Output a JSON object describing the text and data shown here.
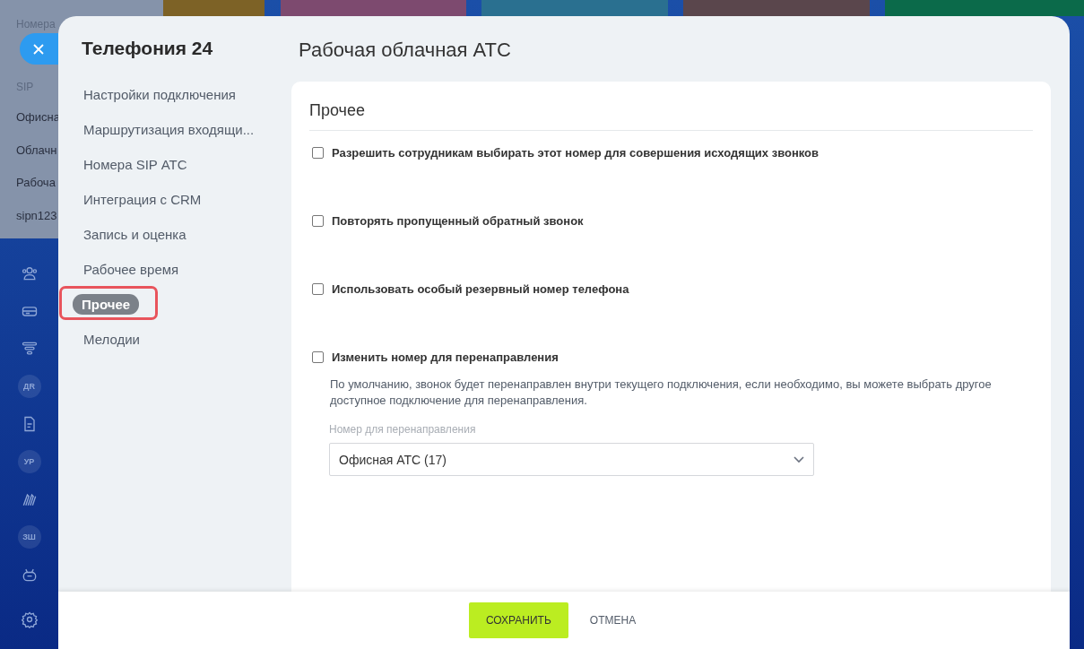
{
  "background_popup": {
    "heading": "Номера",
    "section": "SIP",
    "items": [
      "Офисна",
      "Облачн",
      "Рабоча",
      "sipn123"
    ]
  },
  "rail": [
    {
      "kind": "icon"
    },
    {
      "kind": "icon"
    },
    {
      "kind": "icon"
    },
    {
      "kind": "badge",
      "text": "ДR"
    },
    {
      "kind": "icon"
    },
    {
      "kind": "badge",
      "text": "УР"
    },
    {
      "kind": "icon"
    },
    {
      "kind": "badge",
      "text": "ЗШ"
    },
    {
      "kind": "icon"
    },
    {
      "kind": "icon"
    }
  ],
  "slider": {
    "title": "Телефония 24",
    "nav": [
      {
        "label": "Настройки подключения",
        "selected": false
      },
      {
        "label": "Маршрутизация входящи...",
        "selected": false
      },
      {
        "label": "Номера SIP АТС",
        "selected": false
      },
      {
        "label": "Интеграция с CRM",
        "selected": false
      },
      {
        "label": "Запись и оценка",
        "selected": false
      },
      {
        "label": "Рабочее время",
        "selected": false
      },
      {
        "label": "Прочее",
        "selected": true
      },
      {
        "label": "Мелодии",
        "selected": false
      }
    ],
    "page_title": "Рабочая облачная АТС",
    "section_title": "Прочее",
    "options": [
      {
        "label": "Разрешить сотрудникам выбирать этот номер для совершения исходящих звонков",
        "checked": false
      },
      {
        "label": "Повторять пропущенный обратный звонок",
        "checked": false
      },
      {
        "label": "Использовать особый резервный номер телефона",
        "checked": false
      },
      {
        "label": "Изменить номер для перенаправления",
        "checked": false,
        "description": "По умолчанию, звонок будет перенаправлен внутри текущего подключения, если необходимо, вы можете выбрать другое доступное подключение для перенаправления.",
        "field": {
          "label": "Номер для перенаправления",
          "value": "Офисная АТС (17)"
        }
      }
    ],
    "buttons": {
      "save": "СОХРАНИТЬ",
      "cancel": "ОТМЕНА"
    }
  }
}
